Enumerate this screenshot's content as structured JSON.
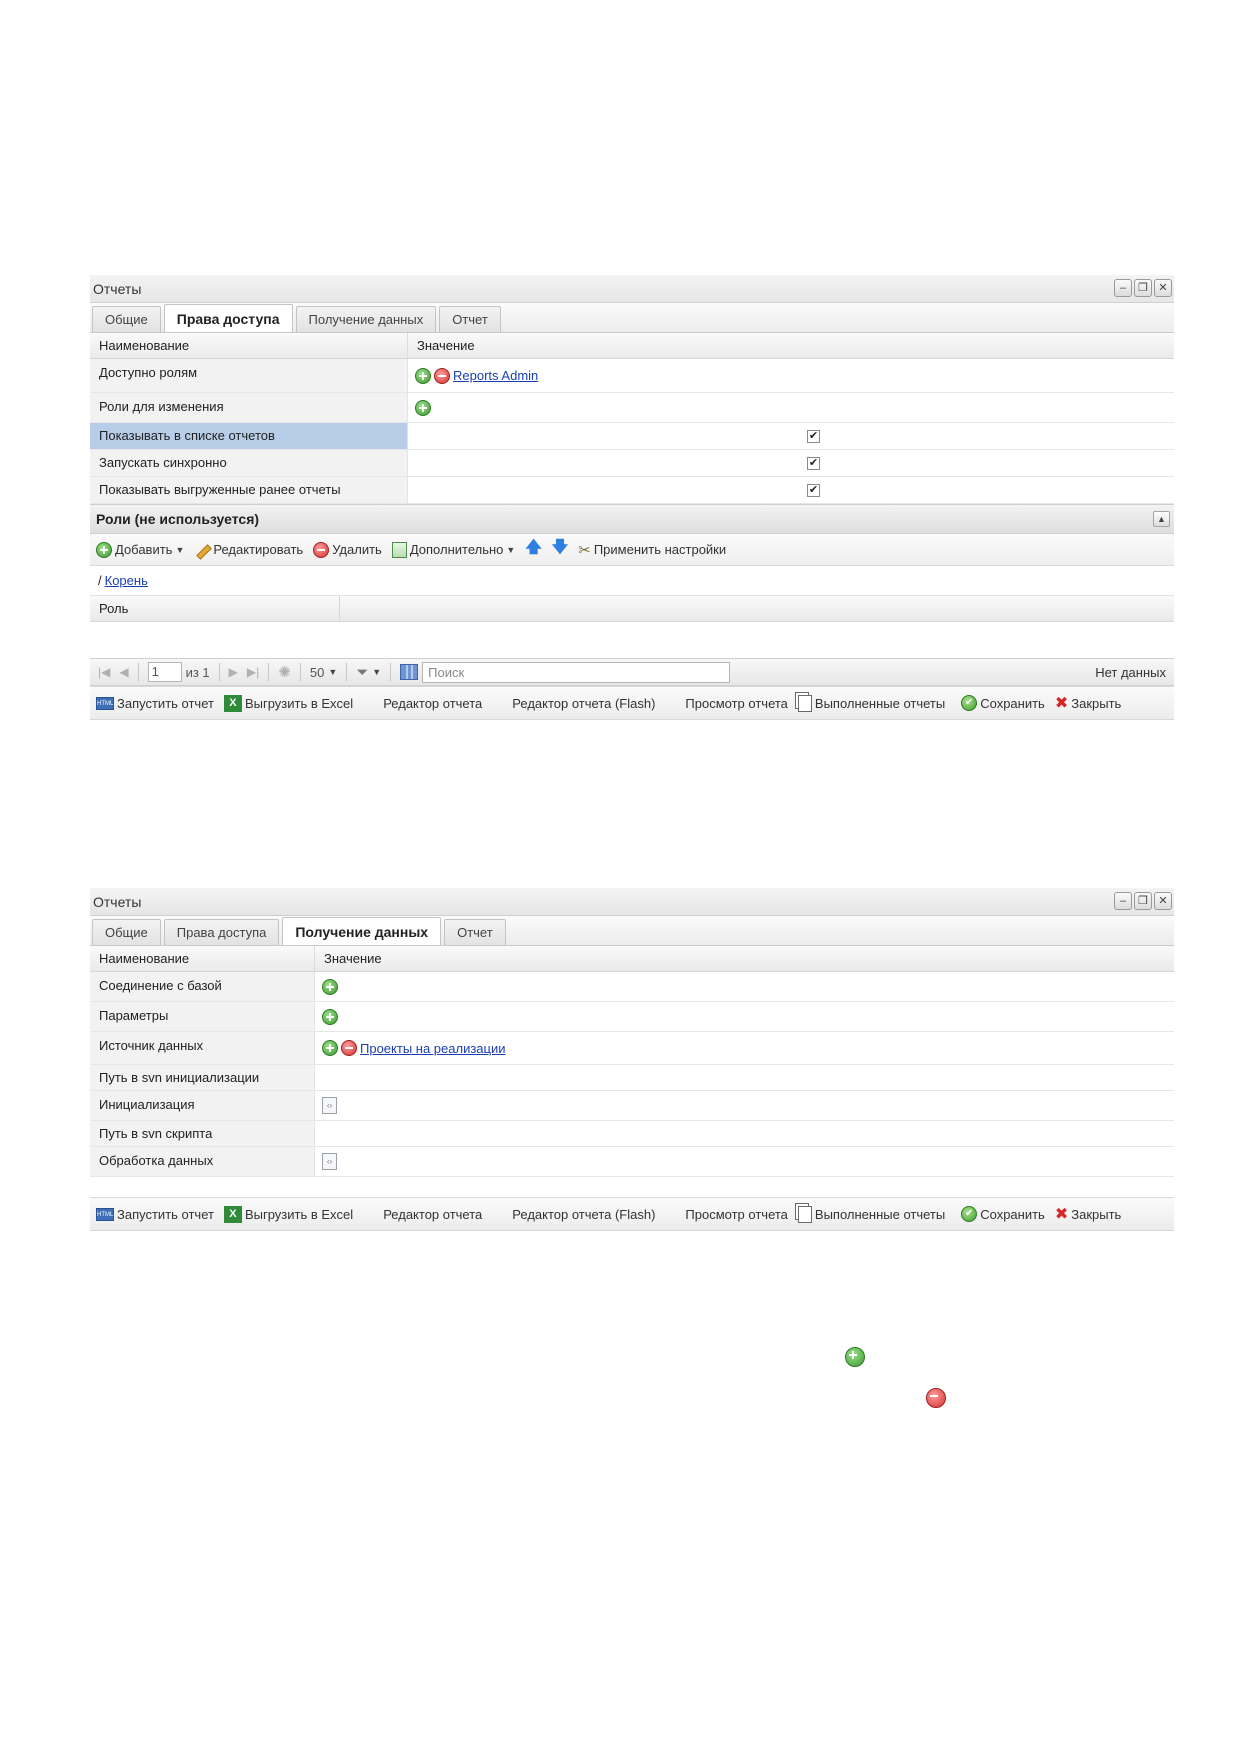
{
  "panel1": {
    "title": "Отчеты",
    "tabs": [
      "Общие",
      "Права доступа",
      "Получение данных",
      "Отчет"
    ],
    "active_tab": 1,
    "columns": [
      "Наименование",
      "Значение"
    ],
    "rows": [
      {
        "name": "Доступно ролям",
        "link": "Reports Admin"
      },
      {
        "name": "Роли для изменения"
      },
      {
        "name": "Показывать в списке отчетов",
        "checked": true
      },
      {
        "name": "Запускать синхронно",
        "checked": true
      },
      {
        "name": "Показывать выгруженные ранее отчеты",
        "checked": true
      }
    ],
    "roles_section": {
      "title": "Роли (не используется)",
      "toolbar": {
        "add": "Добавить",
        "edit": "Редактировать",
        "delete": "Удалить",
        "more": "Дополнительно",
        "apply": "Применить настройки"
      },
      "breadcrumb_root": "Корень",
      "column": "Роль"
    },
    "pager": {
      "page": "1",
      "of_text": "из 1",
      "page_size": "50",
      "search_placeholder": "Поиск",
      "status": "Нет данных"
    }
  },
  "panel2": {
    "title": "Отчеты",
    "tabs": [
      "Общие",
      "Права доступа",
      "Получение данных",
      "Отчет"
    ],
    "active_tab": 2,
    "columns": [
      "Наименование",
      "Значение"
    ],
    "rows": [
      {
        "name": "Соединение с базой"
      },
      {
        "name": "Параметры"
      },
      {
        "name": "Источник данных",
        "link": "Проекты на реализации"
      },
      {
        "name": "Путь в svn инициализации"
      },
      {
        "name": "Инициализация"
      },
      {
        "name": "Путь в svn скрипта"
      },
      {
        "name": "Обработка данных"
      }
    ]
  },
  "bottombar": {
    "run": "Запустить отчет",
    "excel": "Выгрузить в Excel",
    "editor": "Редактор отчета",
    "editor_flash": "Редактор отчета (Flash)",
    "view": "Просмотр отчета",
    "done": "Выполненные отчеты",
    "save": "Сохранить",
    "close": "Закрыть"
  },
  "icons": {
    "add": "add-icon",
    "delete": "delete-icon",
    "edit": "pencil-icon",
    "up": "arrow-up-icon",
    "down": "arrow-down-icon",
    "apply": "wrench-icon",
    "run": "html-icon",
    "excel": "excel-icon",
    "done": "documents-icon",
    "save": "check-icon",
    "close": "x-icon",
    "script": "xml-file-icon"
  },
  "colors": {
    "selected_row": "#b8cee8",
    "link": "#1a3fb5",
    "add": "#3c9a2f",
    "delete": "#d23232"
  }
}
